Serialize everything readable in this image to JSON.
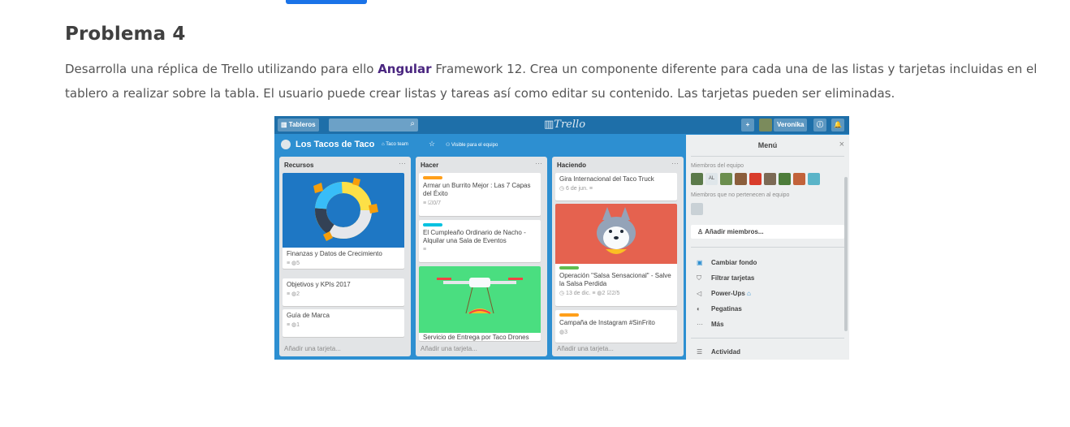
{
  "page": {
    "heading": "Problema 4",
    "para_pre": "Desarrolla una réplica de Trello utilizando para ello ",
    "para_bold": "Angular",
    "para_post": " Framework 12. Crea un componente diferente para cada una de las listas y tarjetas incluidas en el tablero a realizar sobre la tabla. El usuario puede crear listas y tareas así como editar su contenido. Las tarjetas pueden ser eliminadas."
  },
  "trello": {
    "topbar": {
      "boards_label": "Tableros",
      "logo": "Trello",
      "user": "Veronika",
      "plus": "+",
      "info": "ⓘ",
      "bell": "🔔",
      "search_icon": "⌕"
    },
    "board": {
      "title": "Los Tacos de Taco",
      "team": "Taco team",
      "star": "☆",
      "visibility": "Visible para el equipo"
    },
    "lists": [
      {
        "title": "Recursos",
        "add": "Añadir una tarjeta...",
        "cards": [
          {
            "text": "Finanzas y Datos de Crecimiento",
            "meta": "≡  ◍5"
          },
          {
            "text": "Objetivos y KPIs 2017",
            "meta": "≡  ◍2"
          },
          {
            "text": "Guía de Marca",
            "meta": "≡  ◍1"
          }
        ]
      },
      {
        "title": "Hacer",
        "add": "Añadir una tarjeta...",
        "cards": [
          {
            "text": "Armar un Burrito Mejor : Las 7 Capas del Éxito",
            "meta": "≡  ☑0/7"
          },
          {
            "text": "El Cumpleaño Ordinario de Nacho - Alquilar una Sala de Eventos",
            "meta": "≡"
          },
          {
            "text": "Servicio de Entrega por Taco Drones",
            "meta": ""
          }
        ]
      },
      {
        "title": "Haciendo",
        "add": "Añadir una tarjeta...",
        "cards": [
          {
            "text": "Gira Internacional del Taco Truck",
            "meta": "◷ 6 de jun.  ≡"
          },
          {
            "text": "Operación \"Salsa Sensacional\" - Salve la Salsa Perdida",
            "meta": "◷ 13 de dic.  ≡  ◍2  ☑2/5"
          },
          {
            "text": "Campaña de Instagram #SinFrito",
            "meta": "◍3"
          }
        ]
      }
    ],
    "menu": {
      "title": "Menú",
      "close": "×",
      "team_members": "Miembros del equipo",
      "non_team_members": "Miembros que no pertenecen al equipo",
      "add_members": "Añadir miembros...",
      "items": [
        {
          "icon": "▣",
          "label": "Cambiar fondo"
        },
        {
          "icon": "⛉",
          "label": "Filtrar tarjetas"
        },
        {
          "icon": "◁",
          "label": "Power-Ups"
        },
        {
          "icon": "◐",
          "label": "Pegatinas"
        },
        {
          "icon": "···",
          "label": "Más"
        }
      ],
      "activity": "Actividad",
      "activity_icon": "☰"
    },
    "colors": {
      "board_bg": "#2d8fd1",
      "topbar": "#1e6fa9",
      "label_orange": "#ff9f1a",
      "label_cyan": "#00c2e0",
      "label_green": "#61bd4f",
      "link_purple": "#4a2680"
    }
  }
}
